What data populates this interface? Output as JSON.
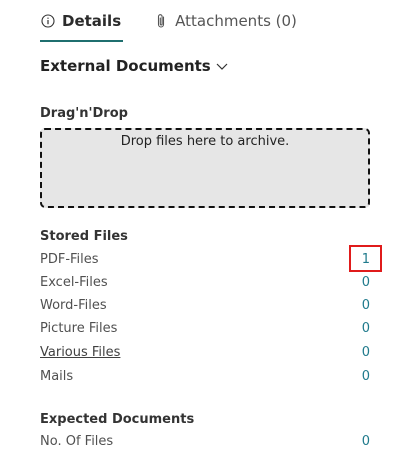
{
  "tabs": {
    "details_label": "Details",
    "details_icon": "info-circle-icon",
    "attachments_label": "Attachments (0)",
    "attachments_icon": "paperclip-icon",
    "active_color": "#1f6f6f"
  },
  "section": {
    "title": "External Documents",
    "chevron_icon": "chevron-down-icon"
  },
  "dragdrop": {
    "label": "Drag'n'Drop",
    "prompt": "Drop files here to archive."
  },
  "stored_files": {
    "title": "Stored Files",
    "rows": [
      {
        "label": "PDF-Files",
        "value": "1"
      },
      {
        "label": "Excel-Files",
        "value": "0"
      },
      {
        "label": "Word-Files",
        "value": "0"
      },
      {
        "label": "Picture Files",
        "value": "0"
      },
      {
        "label": "Various Files",
        "value": "0"
      },
      {
        "label": "Mails",
        "value": "0"
      }
    ]
  },
  "expected_documents": {
    "title": "Expected Documents",
    "rows": [
      {
        "label": "No. Of Files",
        "value": "0"
      }
    ]
  },
  "colors": {
    "value_link": "#1f7a8c",
    "highlight": "#e01b1b"
  }
}
